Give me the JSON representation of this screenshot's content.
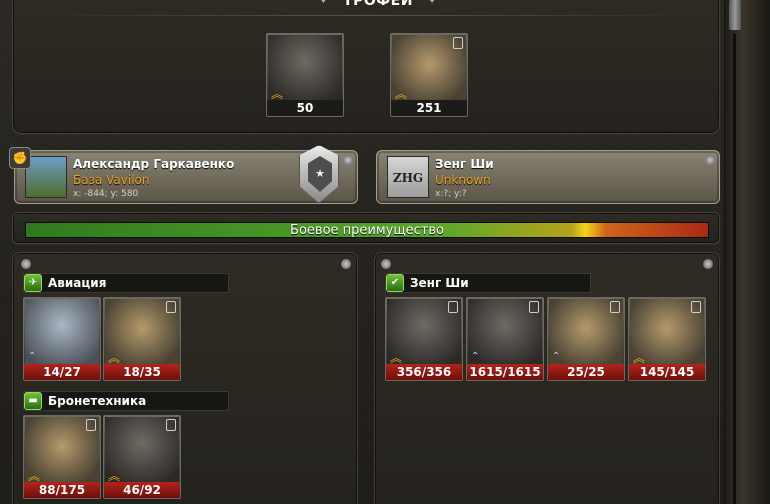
{
  "trophy": {
    "title": "ТРОФЕИ",
    "items": [
      {
        "count": "50",
        "name": "attack-helicopter"
      },
      {
        "count": "251",
        "name": "desert-helicopter"
      }
    ]
  },
  "player_left": {
    "name": "Александр Гаркавенко",
    "base": "База Vavilon",
    "coords": "x: -844; y: 580"
  },
  "player_right": {
    "name": "Зенг Ши",
    "base": "Unknown",
    "coords": "x:?; y:?",
    "avatar_text": "ZHG"
  },
  "advantage": {
    "label": "Боевое преимущество",
    "ratio": 0.82
  },
  "left_army": {
    "groups": [
      {
        "title": "Авиация",
        "icon": "aviation-icon",
        "units": [
          {
            "hp": "14",
            "max": "27",
            "name": "drone"
          },
          {
            "hp": "18",
            "max": "35",
            "name": "desert-helicopter"
          }
        ]
      },
      {
        "title": "Бронетехника",
        "icon": "tank-icon",
        "units": [
          {
            "hp": "88",
            "max": "175",
            "name": "humvee"
          },
          {
            "hp": "46",
            "max": "92",
            "name": "armored-vehicle"
          }
        ]
      }
    ]
  },
  "right_army": {
    "title": "Зенг Ши",
    "units": [
      {
        "hp": "356",
        "max": "356",
        "name": "attack-helicopter"
      },
      {
        "hp": "1615",
        "max": "1615",
        "name": "soldier"
      },
      {
        "hp": "25",
        "max": "25",
        "name": "gas-mask-soldier"
      },
      {
        "hp": "145",
        "max": "145",
        "name": "buggy"
      }
    ]
  },
  "colors": {
    "accent_orange": "#e8a21c",
    "bar_red": "#b2241c",
    "bar_green": "#57a82a"
  }
}
